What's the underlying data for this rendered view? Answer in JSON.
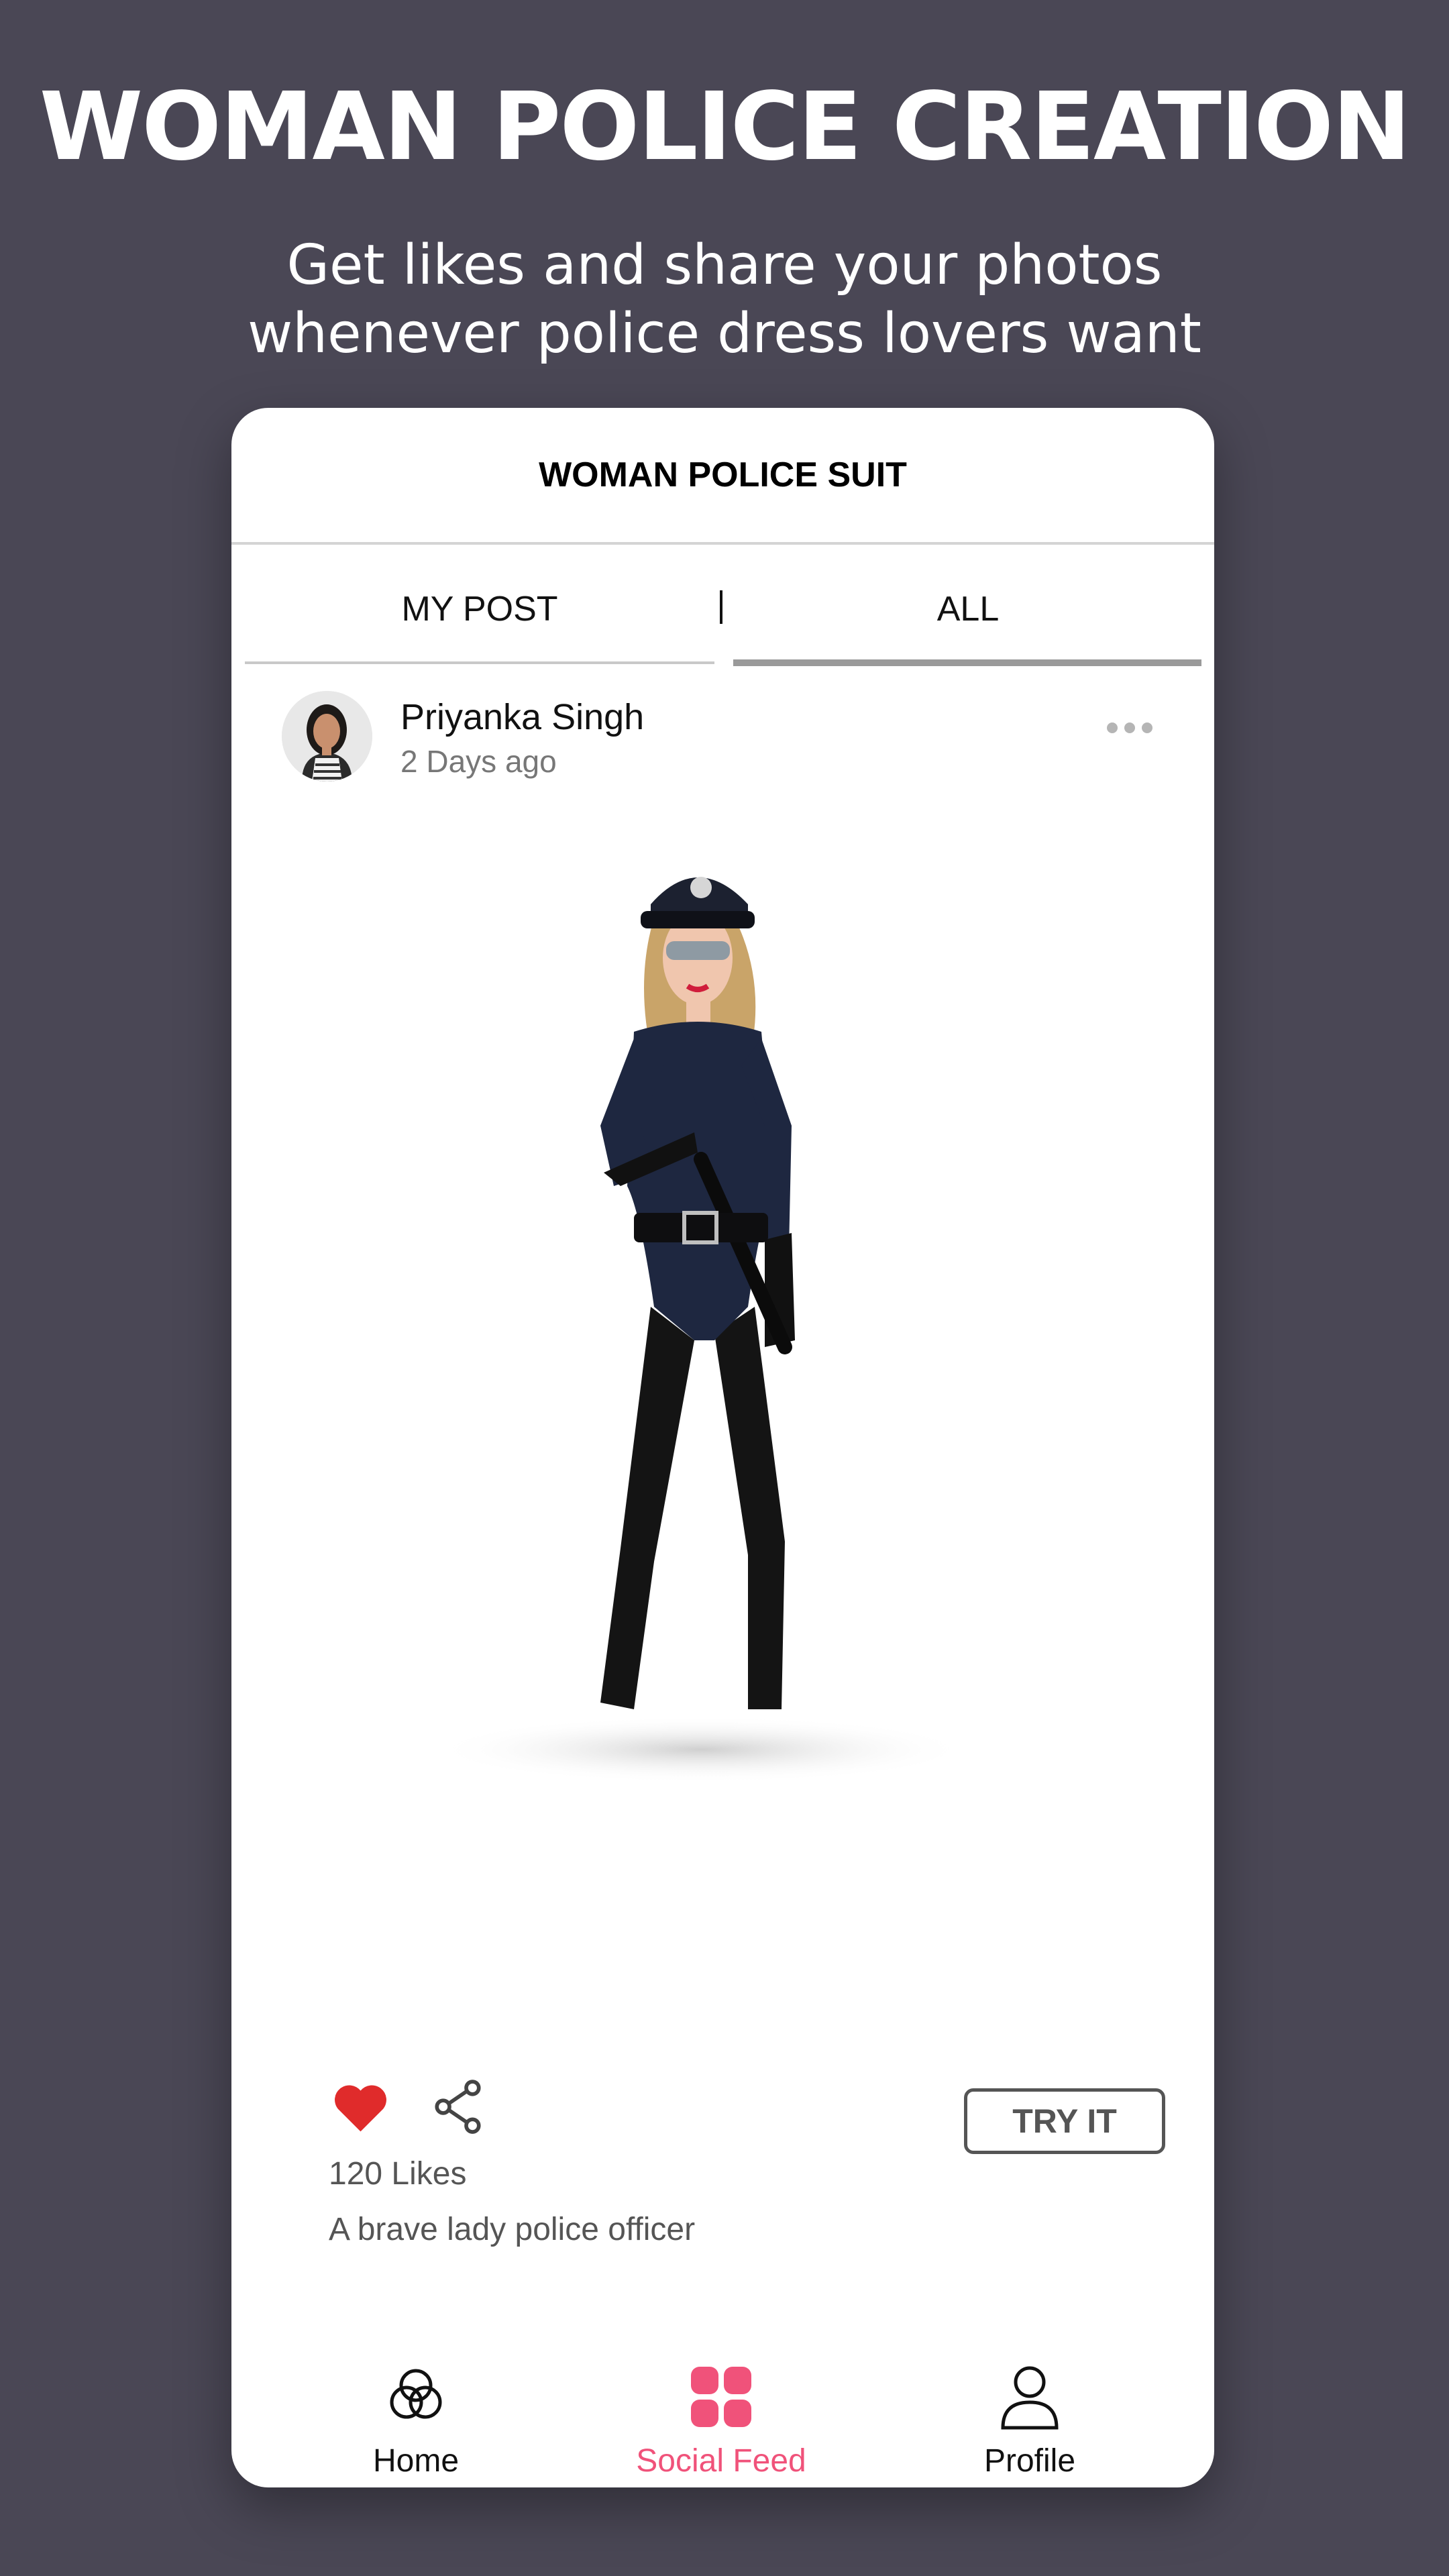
{
  "promo": {
    "headline": "WOMAN POLICE CREATION",
    "subtitle_line1": "Get likes and share your photos",
    "subtitle_line2": "whenever police dress lovers want"
  },
  "app": {
    "title": "WOMAN POLICE SUIT",
    "tabs": [
      {
        "label": "MY POST",
        "active": false
      },
      {
        "label": "ALL",
        "active": true
      }
    ]
  },
  "post": {
    "user_name": "Priyanka Singh",
    "time_ago": "2 Days ago",
    "likes_text": "120 Likes",
    "caption": "A brave lady police officer",
    "try_label": "TRY IT",
    "liked": true,
    "icons": [
      "more-options-icon",
      "heart-icon",
      "share-icon"
    ]
  },
  "bottom_nav": [
    {
      "label": "Home",
      "icon": "home-circles-icon",
      "active": false
    },
    {
      "label": "Social Feed",
      "icon": "grid-icon",
      "active": true
    },
    {
      "label": "Profile",
      "icon": "person-icon",
      "active": false
    }
  ],
  "colors": {
    "background": "#4a4755",
    "accent": "#f0527a",
    "like": "#e02b2b",
    "tab_active_underline": "#9a9a9a"
  }
}
